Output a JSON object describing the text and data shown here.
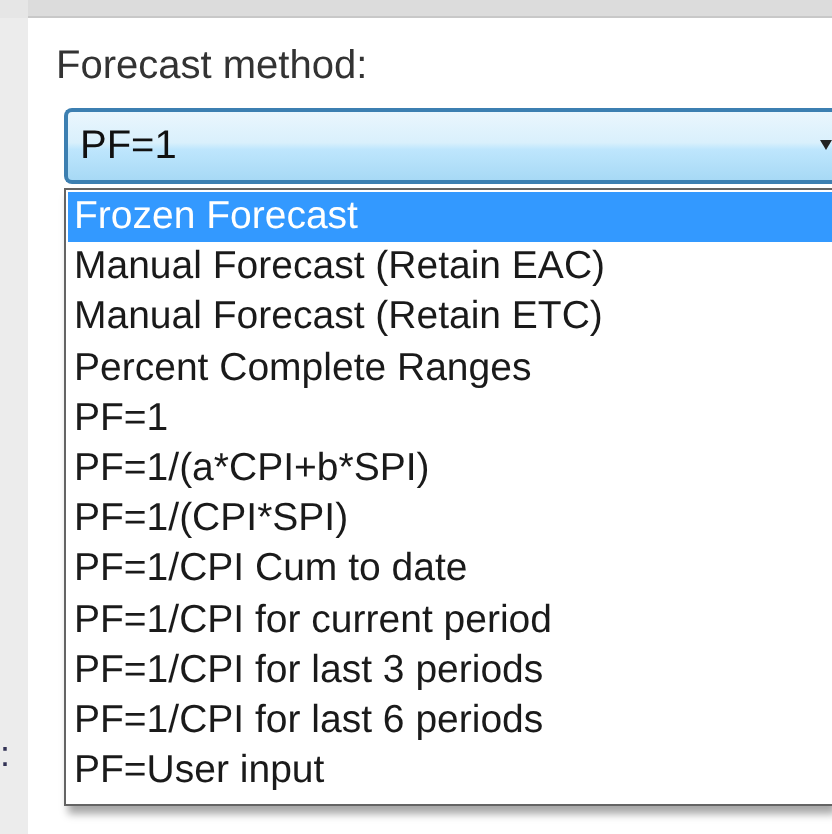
{
  "field_label": "Forecast method:",
  "combo": {
    "value": "PF=1",
    "expanded": true
  },
  "options": [
    {
      "label": "Frozen Forecast",
      "selected": true
    },
    {
      "label": "Manual Forecast (Retain EAC)",
      "selected": false
    },
    {
      "label": "Manual Forecast (Retain ETC)",
      "selected": false
    },
    {
      "label": "Percent Complete Ranges",
      "selected": false
    },
    {
      "label": "PF=1",
      "selected": false
    },
    {
      "label": "PF=1/(a*CPI+b*SPI)",
      "selected": false
    },
    {
      "label": "PF=1/(CPI*SPI)",
      "selected": false
    },
    {
      "label": "PF=1/CPI Cum to date",
      "selected": false
    },
    {
      "label": "PF=1/CPI for current period",
      "selected": false
    },
    {
      "label": "PF=1/CPI for last 3 periods",
      "selected": false
    },
    {
      "label": "PF=1/CPI for last 6 periods",
      "selected": false
    },
    {
      "label": "PF=User input",
      "selected": false
    }
  ],
  "partial_text": ":"
}
